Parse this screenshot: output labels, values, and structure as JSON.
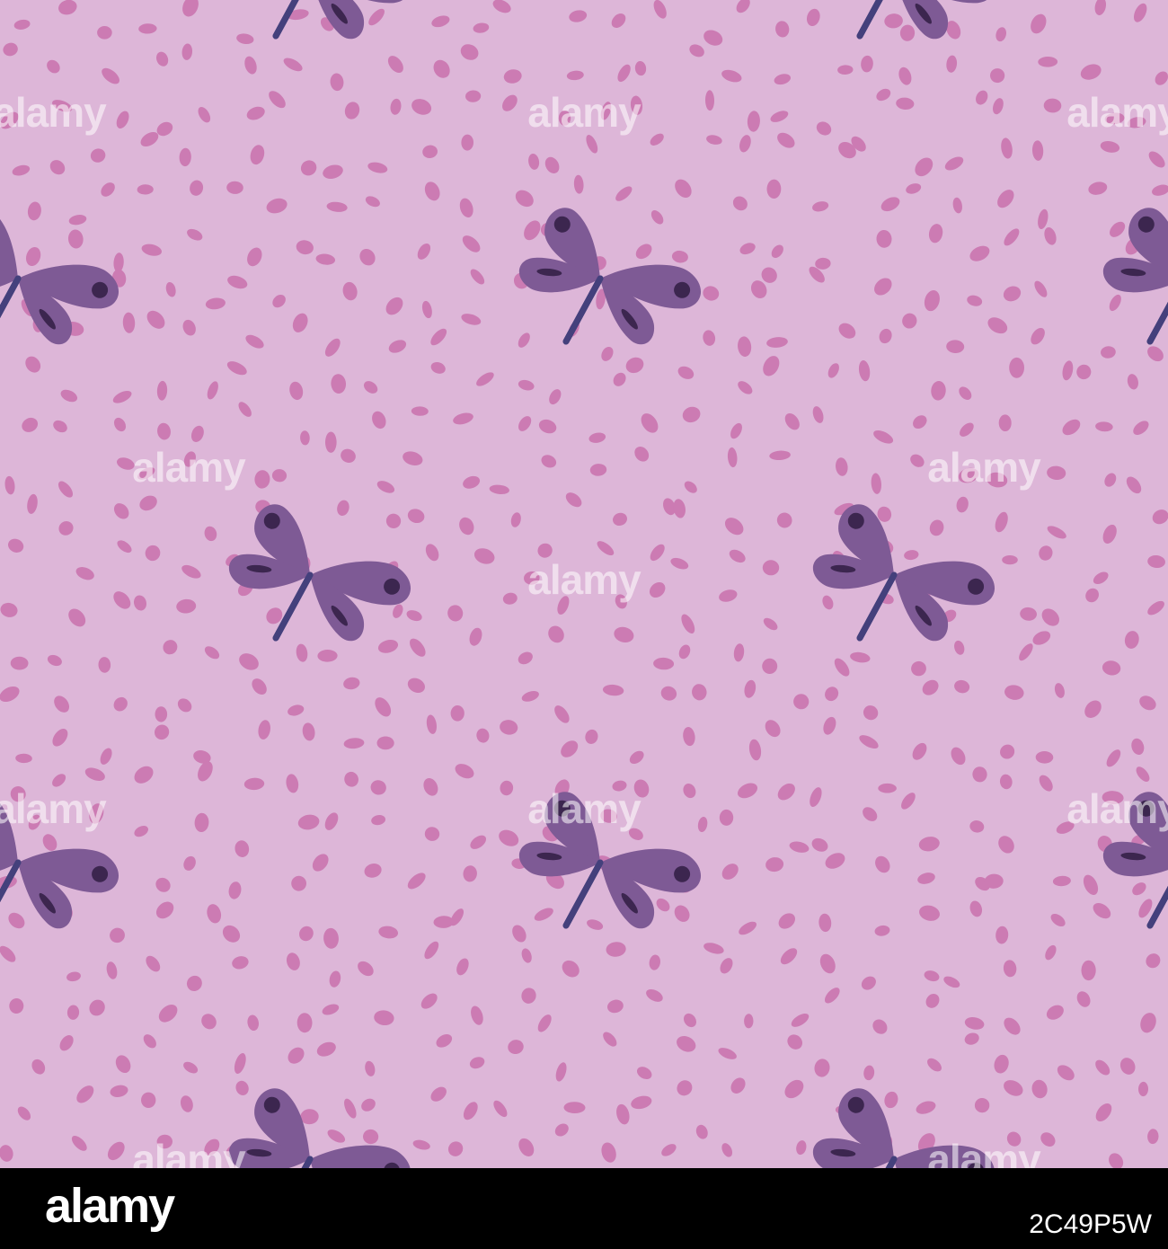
{
  "image": {
    "background_color": "#DDB6D8",
    "dot_color": "#CC7BB3",
    "wing_color": "#7E5A95",
    "wing_spot_color": "#3C264F",
    "body_color": "#44407C",
    "motif_icon": "dragonfly-icon",
    "dot_icon": "petal-dot-icon"
  },
  "watermark": {
    "text": "alamy",
    "color": "#FFFFFF"
  },
  "footer": {
    "brand": "alamy",
    "image_id": "2C49P5W",
    "background_color": "#000000",
    "text_color": "#FFFFFF"
  }
}
